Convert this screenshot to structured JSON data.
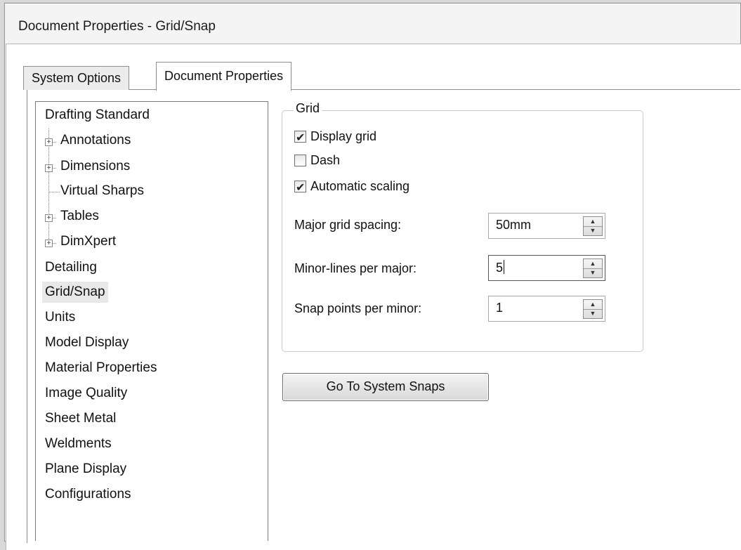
{
  "window": {
    "title": "Document Properties - Grid/Snap"
  },
  "tabs": [
    {
      "label": "System Options",
      "active": false
    },
    {
      "label": "Document Properties",
      "active": true
    }
  ],
  "tree": {
    "items": [
      {
        "label": "Drafting Standard",
        "level": 0
      },
      {
        "label": "Annotations",
        "level": 1,
        "expandable": true
      },
      {
        "label": "Dimensions",
        "level": 1,
        "expandable": true
      },
      {
        "label": "Virtual Sharps",
        "level": 1,
        "expandable": false
      },
      {
        "label": "Tables",
        "level": 1,
        "expandable": true
      },
      {
        "label": "DimXpert",
        "level": 1,
        "expandable": true
      },
      {
        "label": "Detailing",
        "level": 0
      },
      {
        "label": "Grid/Snap",
        "level": 0,
        "selected": true
      },
      {
        "label": "Units",
        "level": 0
      },
      {
        "label": "Model Display",
        "level": 0
      },
      {
        "label": "Material Properties",
        "level": 0
      },
      {
        "label": "Image Quality",
        "level": 0
      },
      {
        "label": "Sheet Metal",
        "level": 0
      },
      {
        "label": "Weldments",
        "level": 0
      },
      {
        "label": "Plane Display",
        "level": 0
      },
      {
        "label": "Configurations",
        "level": 0
      }
    ]
  },
  "grid": {
    "group_label": "Grid",
    "checkboxes": [
      {
        "label": "Display grid",
        "checked": true
      },
      {
        "label": "Dash",
        "checked": false
      },
      {
        "label": "Automatic scaling",
        "checked": true
      }
    ],
    "fields": [
      {
        "label": "Major grid spacing:",
        "value": "50mm"
      },
      {
        "label": "Minor-lines per major:",
        "value": "5"
      },
      {
        "label": "Snap points per minor:",
        "value": "1"
      }
    ]
  },
  "buttons": {
    "go_to_system_snaps": "Go To System Snaps"
  },
  "icons": {
    "expander": "plus-box-icon",
    "spin_up": "triangle-up-icon",
    "spin_down": "triangle-down-icon",
    "check": "checkmark-icon"
  }
}
